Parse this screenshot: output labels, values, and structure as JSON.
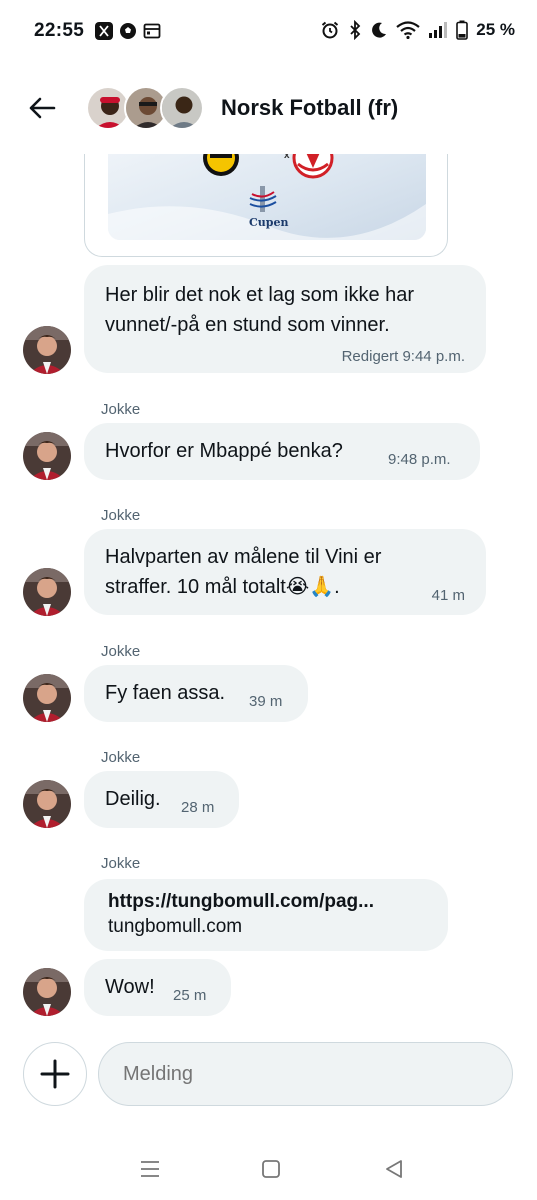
{
  "status_bar": {
    "time": "22:55",
    "notification_icons": [
      "x-logo-icon",
      "football-icon",
      "calendar-icon"
    ],
    "system_icons": [
      "alarm-icon",
      "bluetooth-icon",
      "moon-icon",
      "wifi-icon",
      "signal-icon",
      "battery-icon"
    ],
    "battery_percent": "25 %"
  },
  "header": {
    "title": "Norsk Fotball (fr)"
  },
  "card": {
    "separator": "x",
    "logo_text": "Cupen"
  },
  "messages": [
    {
      "sender": "",
      "text": "Her blir det nok et lag som ikke har vunnet/-på en stund som vinner.",
      "time": "Redigert 9:44 p.m."
    },
    {
      "sender": "Jokke",
      "text": "Hvorfor er Mbappé benka?",
      "time": "9:48 p.m."
    },
    {
      "sender": "Jokke",
      "text": "Halvparten av målene til Vini er straffer. 10 mål totalt😭🙏.",
      "time": "41 m"
    },
    {
      "sender": "Jokke",
      "text": "Fy faen assa.",
      "time": "39 m"
    },
    {
      "sender": "Jokke",
      "text": "Deilig.",
      "time": "28 m"
    },
    {
      "sender": "Jokke",
      "link_url": "https://tungbomull.com/pag...",
      "link_domain": "tungbomull.com"
    },
    {
      "sender": "",
      "text": "Wow!",
      "time": "25 m"
    }
  ],
  "composer": {
    "placeholder": "Melding"
  },
  "colors": {
    "bubble": "#eff3f4",
    "meta_text": "#536471",
    "border": "#cfd9de"
  }
}
